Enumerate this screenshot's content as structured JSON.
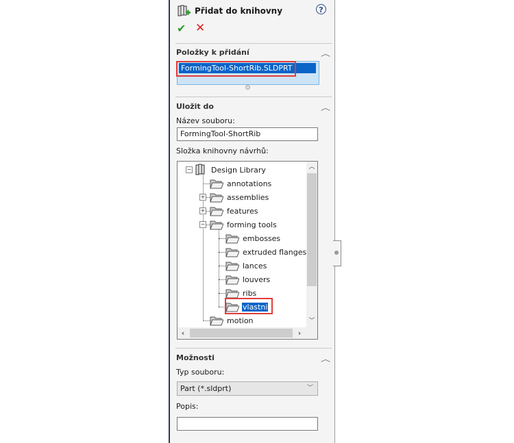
{
  "panel": {
    "title": "Přidat do knihovny",
    "help_icon": "?",
    "ok_icon": "✔",
    "cancel_icon": "✕"
  },
  "items_section": {
    "title": "Položky k přidání",
    "items": [
      "FormingTool-ShortRib.SLDPRT"
    ]
  },
  "save_section": {
    "title": "Uložit do",
    "filename_label": "Název souboru:",
    "filename_value": "FormingTool-ShortRib",
    "folder_label": "Složka knihovny návrhů:",
    "tree": [
      {
        "label": "Design Library",
        "level": 0,
        "expander": "−",
        "icon": "library-icon"
      },
      {
        "label": "annotations",
        "level": 1,
        "expander": "",
        "icon": "folder-icon"
      },
      {
        "label": "assemblies",
        "level": 1,
        "expander": "+",
        "icon": "folder-icon"
      },
      {
        "label": "features",
        "level": 1,
        "expander": "+",
        "icon": "folder-icon"
      },
      {
        "label": "forming tools",
        "level": 1,
        "expander": "−",
        "icon": "folder-icon"
      },
      {
        "label": "embosses",
        "level": 2,
        "expander": "",
        "icon": "folder-icon"
      },
      {
        "label": "extruded flanges",
        "level": 2,
        "expander": "",
        "icon": "folder-icon"
      },
      {
        "label": "lances",
        "level": 2,
        "expander": "",
        "icon": "folder-icon"
      },
      {
        "label": "louvers",
        "level": 2,
        "expander": "",
        "icon": "folder-icon"
      },
      {
        "label": "ribs",
        "level": 2,
        "expander": "",
        "icon": "folder-icon"
      },
      {
        "label": "vlastni",
        "level": 2,
        "expander": "",
        "icon": "folder-icon",
        "selected": true
      },
      {
        "label": "motion",
        "level": 1,
        "expander": "",
        "icon": "folder-icon"
      }
    ]
  },
  "options_section": {
    "title": "Možnosti",
    "filetype_label": "Typ souboru:",
    "filetype_value": "Part (*.sldprt)",
    "description_label": "Popis:",
    "description_value": ""
  },
  "colors": {
    "selection": "#0a64c8",
    "highlight_box": "#e03c3c",
    "ok": "#2e9c2e",
    "cancel": "#e02020"
  }
}
